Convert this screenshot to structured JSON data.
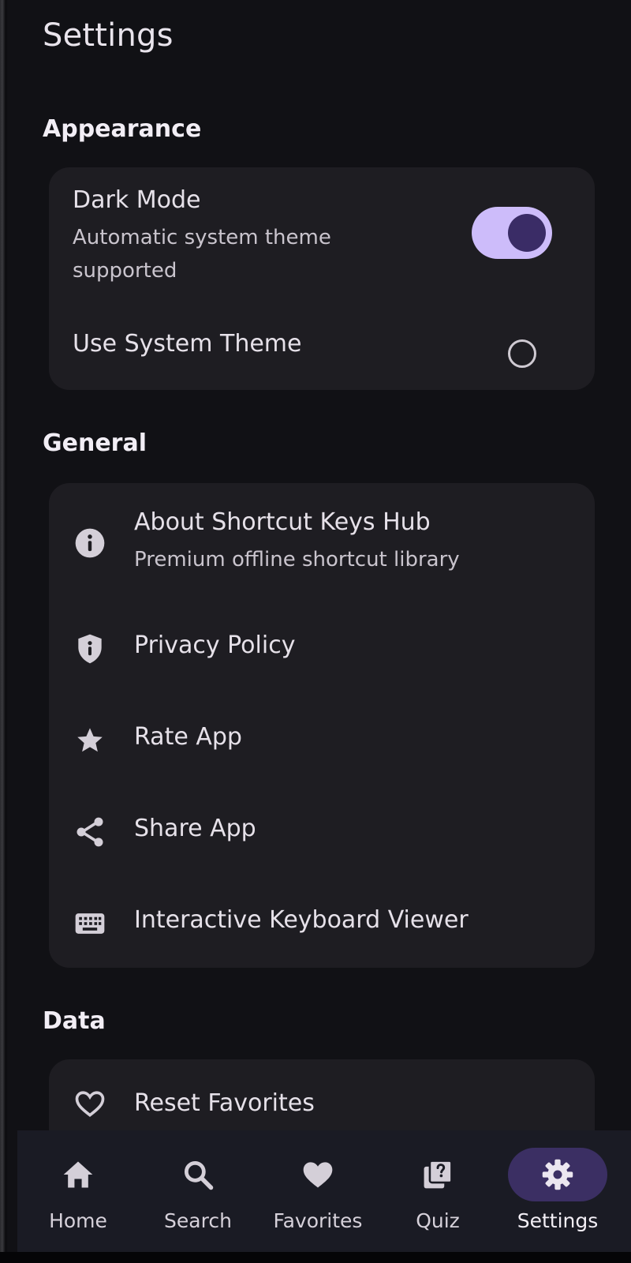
{
  "header": {
    "title": "Settings"
  },
  "sections": {
    "appearance": {
      "title": "Appearance",
      "dark_mode": {
        "title": "Dark Mode",
        "subtitle_line1": "Automatic system theme",
        "subtitle_line2": "supported",
        "enabled": true
      },
      "system_theme": {
        "title": "Use System Theme",
        "selected": false
      }
    },
    "general": {
      "title": "General",
      "items": [
        {
          "icon": "info-icon",
          "title": "About Shortcut Keys Hub",
          "subtitle": "Premium offline shortcut library"
        },
        {
          "icon": "shield-icon",
          "title": "Privacy Policy"
        },
        {
          "icon": "star-icon",
          "title": "Rate App"
        },
        {
          "icon": "share-icon",
          "title": "Share App"
        },
        {
          "icon": "keyboard-icon",
          "title": "Interactive Keyboard Viewer"
        }
      ]
    },
    "data": {
      "title": "Data",
      "items": [
        {
          "icon": "heart-outline-icon",
          "title": "Reset Favorites"
        }
      ]
    }
  },
  "bottom_nav": {
    "items": [
      {
        "icon": "home-icon",
        "label": "Home",
        "active": false
      },
      {
        "icon": "search-icon",
        "label": "Search",
        "active": false
      },
      {
        "icon": "heart-icon",
        "label": "Favorites",
        "active": false
      },
      {
        "icon": "quiz-icon",
        "label": "Quiz",
        "active": false
      },
      {
        "icon": "gear-icon",
        "label": "Settings",
        "active": true
      }
    ]
  },
  "colors": {
    "background": "#111115",
    "card": "#1e1d22",
    "accent": "#cdbcfa",
    "accent_dark": "#3a2c66",
    "nav_background": "#1a1b24",
    "nav_active_pill": "#3b2f63"
  }
}
